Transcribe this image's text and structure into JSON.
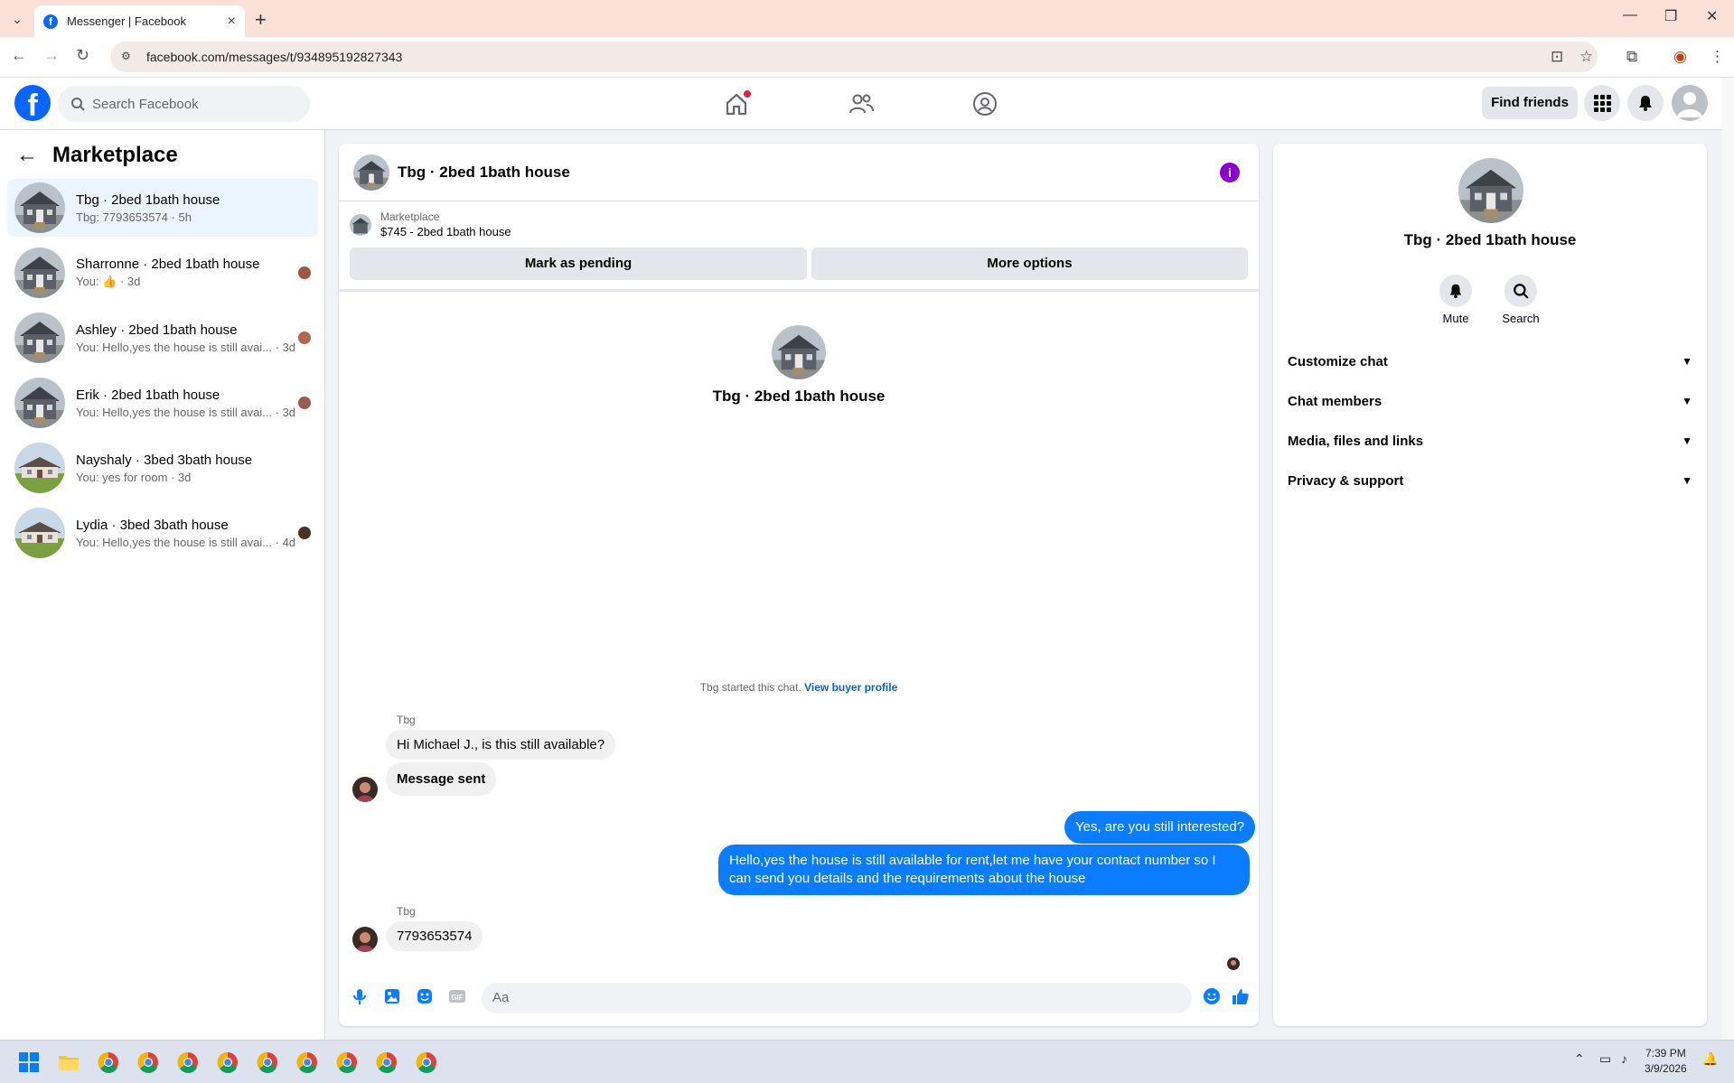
{
  "browser": {
    "tab_title": "Messenger | Facebook",
    "url": "facebook.com/messages/t/934895192827343"
  },
  "topnav": {
    "search_placeholder": "Search Facebook",
    "find_friends": "Find friends"
  },
  "sidebar": {
    "title": "Marketplace",
    "conversations": [
      {
        "name": "Tbg · 2bed 1bath house",
        "sub": "Tbg: 7793653574 · 5h"
      },
      {
        "name": "Sharronne · 2bed 1bath house",
        "sub": "You: 👍 · 3d"
      },
      {
        "name": "Ashley · 2bed 1bath house",
        "sub": "You: Hello,yes the house is still avai... · 3d"
      },
      {
        "name": "Erik · 2bed 1bath house",
        "sub": "You: Hello,yes the house is still avai... · 3d"
      },
      {
        "name": "Nayshaly · 3bed 3bath house",
        "sub": "You: yes for room · 3d"
      },
      {
        "name": "Lydia · 3bed 3bath house",
        "sub": "You: Hello,yes the house is still avai... · 4d"
      }
    ]
  },
  "chat": {
    "title": "Tbg · 2bed 1bath house",
    "marketplace_label": "Marketplace",
    "listing": "$745 - 2bed 1bath house",
    "mark_pending": "Mark as pending",
    "more_options": "More options",
    "hero_title": "Tbg · 2bed 1bath house",
    "started_text": "Tbg started this chat.",
    "view_profile": "View buyer profile",
    "sender_name_1": "Tbg",
    "msg_in_1": "Hi Michael J., is this still available?",
    "msg_in_2": "Message sent",
    "msg_out_1": "Yes, are you still interested?",
    "msg_out_2": "Hello,yes the house is still available for rent,let me have your contact number so I can send you details and the requirements about the house",
    "sender_name_2": "Tbg",
    "msg_in_3": "7793653574",
    "composer_placeholder": "Aa"
  },
  "details": {
    "title": "Tbg · 2bed 1bath house",
    "mute": "Mute",
    "search": "Search",
    "sections": [
      "Customize chat",
      "Chat members",
      "Media, files and links",
      "Privacy & support"
    ]
  },
  "taskbar": {
    "time": "7:39 PM",
    "date": "3/9/2026"
  },
  "colors": {
    "accent": "#0866ff",
    "bubble_out": "#0a7cff",
    "info": "#8a00d4"
  }
}
